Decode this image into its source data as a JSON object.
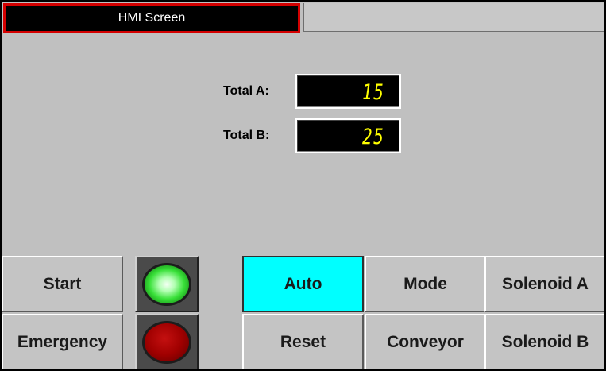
{
  "header": {
    "title": "HMI Screen"
  },
  "totals": [
    {
      "label": "Total A:",
      "value": "15"
    },
    {
      "label": "Total B:",
      "value": "25"
    }
  ],
  "indicators": {
    "run_lamp": {
      "color": "#38e038",
      "state": "on"
    },
    "stop_lamp": {
      "color": "#a00000",
      "state": "off"
    }
  },
  "buttons": {
    "start": "Start",
    "emergency": "Emergency",
    "auto": "Auto",
    "reset": "Reset",
    "mode": "Mode",
    "conveyor": "Conveyor",
    "solenoid_a": "Solenoid A",
    "solenoid_b": "Solenoid B"
  },
  "colors": {
    "background": "#c0c0c0",
    "title_border": "#d40000",
    "active_button": "#00ffff",
    "readout_digits": "#ffff00"
  }
}
